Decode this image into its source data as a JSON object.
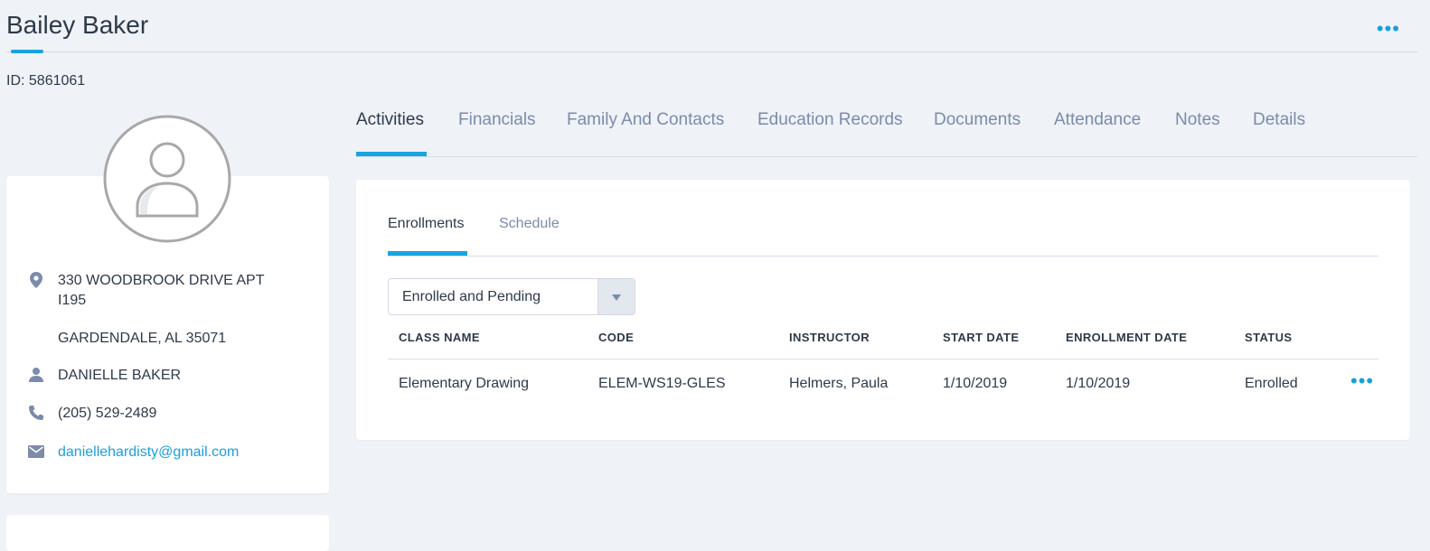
{
  "header": {
    "title": "Bailey Baker",
    "more_label": "•••",
    "student_id": "ID: 5861061"
  },
  "profile": {
    "address_line1": "330 WOODBROOK DRIVE APT I195",
    "address_line2": "GARDENDALE, AL 35071",
    "contact_name": "DANIELLE BAKER",
    "phone": "(205) 529-2489",
    "email": "daniellehardisty@gmail.com",
    "icons": [
      "location-pin-icon",
      "person-icon",
      "phone-icon",
      "email-icon"
    ]
  },
  "tabs": [
    {
      "label": "Activities",
      "active": true
    },
    {
      "label": "Financials"
    },
    {
      "label": "Family And Contacts"
    },
    {
      "label": "Education Records"
    },
    {
      "label": "Documents"
    },
    {
      "label": "Attendance"
    },
    {
      "label": "Notes"
    },
    {
      "label": "Details"
    }
  ],
  "subtabs": [
    {
      "label": "Enrollments",
      "active": true
    },
    {
      "label": "Schedule"
    }
  ],
  "filter": {
    "selected": "Enrolled and Pending"
  },
  "table": {
    "columns": [
      "CLASS NAME",
      "CODE",
      "INSTRUCTOR",
      "START DATE",
      "ENROLLMENT DATE",
      "STATUS"
    ],
    "rows": [
      [
        "Elementary Drawing",
        "ELEM-WS19-GLES",
        "Helmers, Paula",
        "1/10/2019",
        "1/10/2019",
        "Enrolled"
      ]
    ],
    "row_more_label": "•••"
  },
  "colors": {
    "accent": "#1aa3e0",
    "link": "#1a9fd9",
    "background": "#eff2f7",
    "muted_tab": "#7b8bab"
  }
}
